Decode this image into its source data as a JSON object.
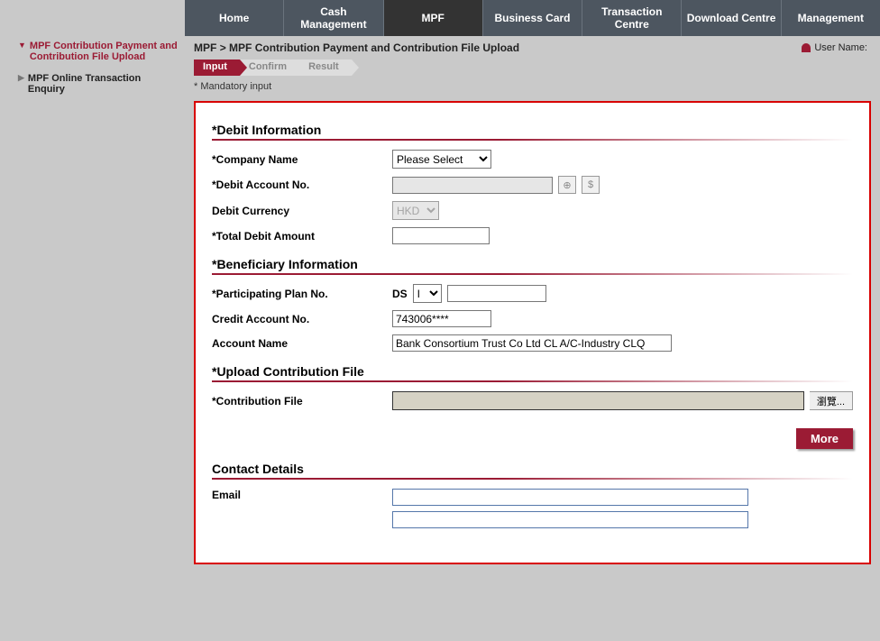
{
  "nav": {
    "items": [
      {
        "label": "Home"
      },
      {
        "label": "Cash Management"
      },
      {
        "label": "MPF",
        "active": true
      },
      {
        "label": "Business Card"
      },
      {
        "label": "Transaction Centre"
      },
      {
        "label": "Download Centre"
      },
      {
        "label": "Management"
      }
    ]
  },
  "sidebar": {
    "items": [
      {
        "label": "MPF Contribution Payment and Contribution File Upload",
        "active": true
      },
      {
        "label": "MPF Online Transaction Enquiry",
        "active": false
      }
    ]
  },
  "breadcrumb": {
    "root": "MPF",
    "sep": ">",
    "current": "MPF Contribution Payment and Contribution File Upload"
  },
  "user": {
    "label": "User Name:",
    "value": ""
  },
  "steps": [
    {
      "label": "Input",
      "active": true
    },
    {
      "label": "Confirm",
      "active": false
    },
    {
      "label": "Result",
      "active": false
    }
  ],
  "mandatory_note": "* Mandatory input",
  "sections": {
    "debit": {
      "title": "*Debit Information",
      "company_name": {
        "label": "*Company Name",
        "placeholder": "Please Select"
      },
      "debit_account": {
        "label": "*Debit Account No.",
        "value": ""
      },
      "debit_currency": {
        "label": "Debit Currency",
        "value": "HKD"
      },
      "total_amount": {
        "label": "*Total Debit Amount",
        "value": ""
      }
    },
    "beneficiary": {
      "title": "*Beneficiary Information",
      "plan_no": {
        "label": "*Participating Plan No.",
        "prefix": "DS",
        "select": "I",
        "value": ""
      },
      "credit_account": {
        "label": "Credit Account No.",
        "value": "743006****"
      },
      "account_name": {
        "label": "Account Name",
        "value": "Bank Consortium Trust Co Ltd CL A/C-Industry CLQ"
      }
    },
    "upload": {
      "title": "*Upload Contribution File",
      "file": {
        "label": "*Contribution File",
        "browse": "瀏覽..."
      },
      "more": "More"
    },
    "contact": {
      "title": "Contact Details",
      "email": {
        "label": "Email",
        "value1": "",
        "value2": ""
      }
    }
  },
  "icons": {
    "search": "⊕",
    "dollar": "$"
  }
}
